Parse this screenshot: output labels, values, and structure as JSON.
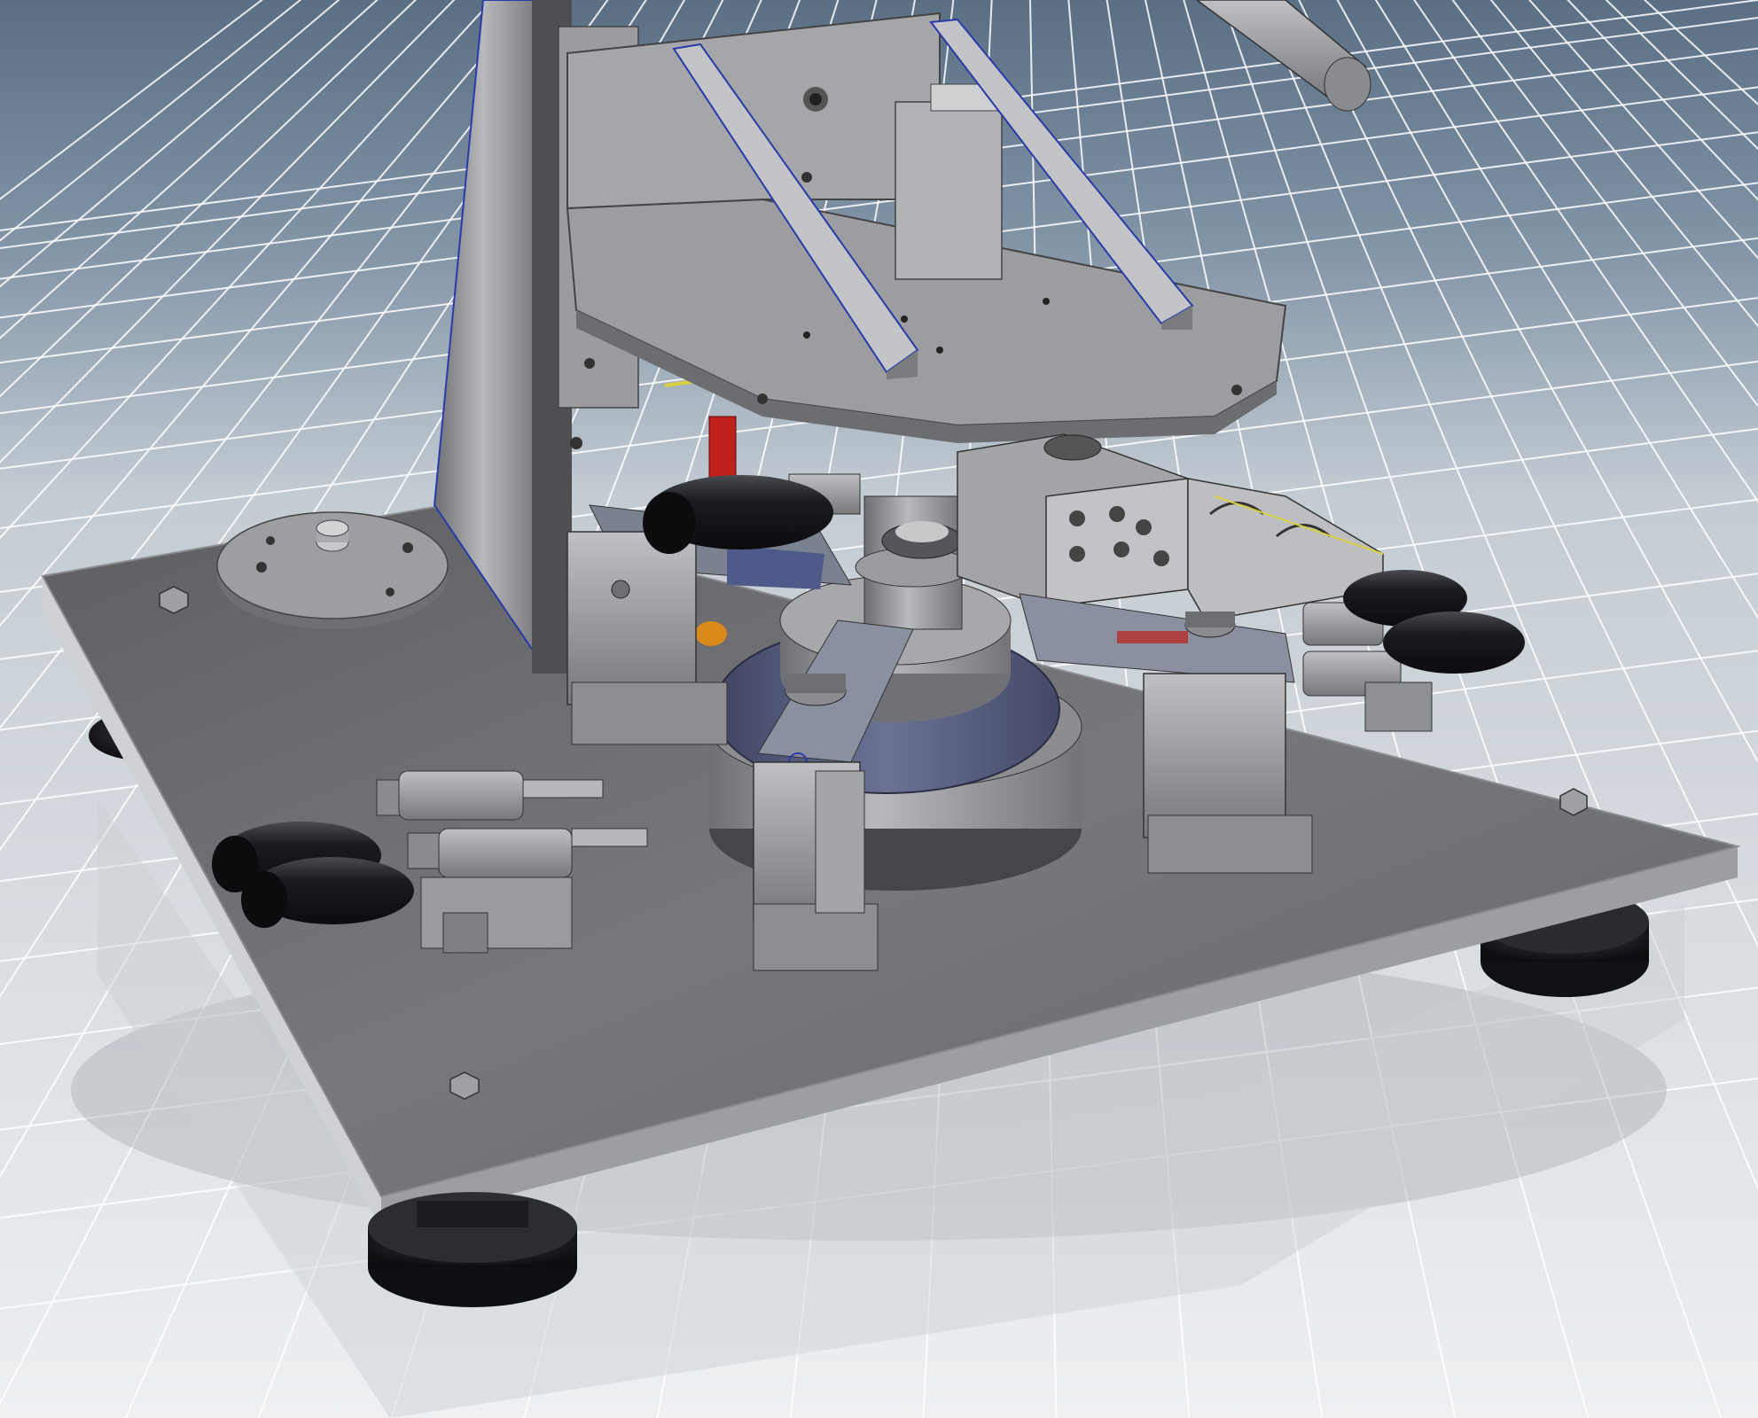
{
  "scene": {
    "kind": "cad-render",
    "subject": "fixture-assembly-on-baseplate",
    "components": [
      "column",
      "top-platform",
      "gusset-left",
      "gusset-right",
      "rotary-table",
      "center-spindle",
      "valve-block",
      "toggle-clamp",
      "clamp-block",
      "lever-handle",
      "leveling-foot",
      "locating-disc",
      "hex-nut",
      "grid-floor"
    ]
  },
  "colors": {
    "background_top": "#5f7488",
    "background_mid": "#c4ccd3",
    "floor": "#e9ecef",
    "grid_line": "#ffffff",
    "steel": "#8e8f93",
    "steel_light": "#b9babd",
    "steel_dark": "#58595c",
    "plate_top": "#6f7074",
    "plate_edge": "#b3b5b8",
    "knob_black": "#15161a",
    "rotary_blue": "#5c6383",
    "edge_blue": "#2a3aa8",
    "accent_red": "#c0201a",
    "accent_orange": "#d98a1a",
    "accent_yellow": "#d8d040"
  }
}
